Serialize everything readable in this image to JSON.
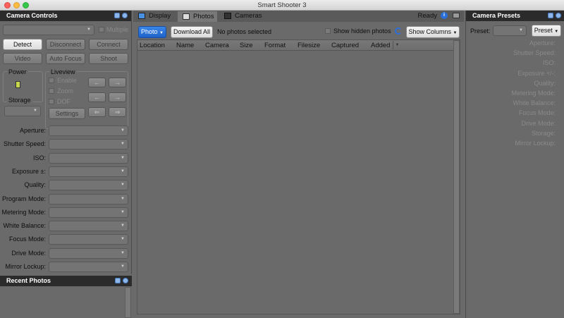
{
  "window": {
    "title": "Smart Shooter 3"
  },
  "left_panel": {
    "title": "Camera Controls",
    "multiple_label": "Multiple",
    "buttons": {
      "detect": "Detect",
      "disconnect": "Disconnect",
      "connect": "Connect",
      "video": "Video",
      "autofocus": "Auto Focus",
      "shoot": "Shoot"
    },
    "power_label": "Power",
    "storage_label": "Storage",
    "liveview": {
      "title": "Liveview",
      "enable": "Enable",
      "zoom": "Zoom",
      "dof": "DOF",
      "settings": "Settings"
    },
    "settings_rows": [
      "Aperture:",
      "Shutter Speed:",
      "ISO:",
      "Exposure ±:",
      "Quality:",
      "Program Mode:",
      "Metering Mode:",
      "White Balance:",
      "Focus Mode:",
      "Drive Mode:",
      "Mirror Lockup:"
    ]
  },
  "recent_panel": {
    "title": "Recent Photos"
  },
  "center": {
    "tabs": [
      {
        "label": "Display"
      },
      {
        "label": "Photos"
      },
      {
        "label": "Cameras"
      }
    ],
    "status": "Ready",
    "toolbar": {
      "photo": "Photo",
      "download_all": "Download All",
      "no_photos": "No photos selected",
      "show_hidden": "Show hidden photos",
      "show_columns": "Show Columns"
    },
    "columns": [
      "Location",
      "Name",
      "Camera",
      "Size",
      "Format",
      "Filesize",
      "Captured",
      "Added"
    ]
  },
  "right_panel": {
    "title": "Camera Presets",
    "preset_label": "Preset:",
    "preset_button": "Preset",
    "fields": [
      "Aperture:",
      "Shutter Speed:",
      "ISO:",
      "Exposure +/-:",
      "Quality:",
      "Metering Mode:",
      "White Balance:",
      "Focus Mode:",
      "Drive Mode:",
      "Storage:",
      "Mirror Lockup:"
    ]
  },
  "colors": {
    "accent": "#2a6fd8",
    "panel_bg": "#6a6a6a",
    "header_bg": "#2b2b2b"
  },
  "icons": [
    "close-icon",
    "minimize-icon",
    "zoom-icon",
    "float-icon",
    "close-panel-icon",
    "monitor-icon",
    "photos-icon",
    "cameras-icon",
    "info-icon",
    "refresh-icon",
    "battery-icon"
  ]
}
